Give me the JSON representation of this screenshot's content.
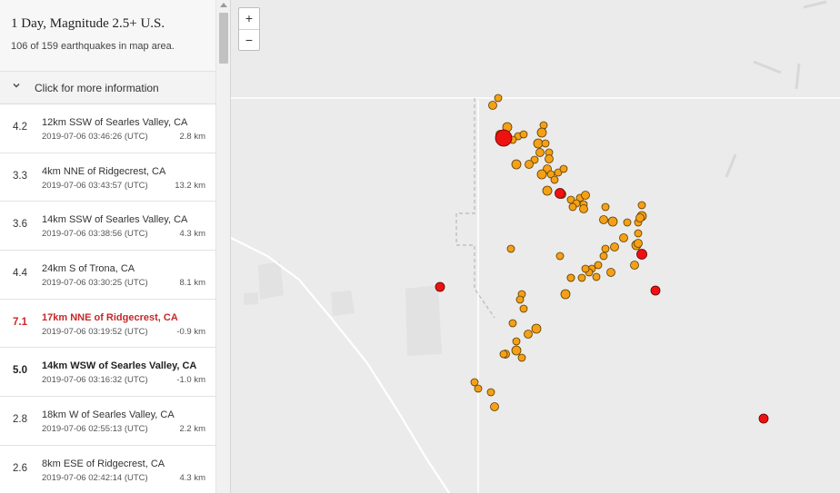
{
  "sidebar": {
    "title": "1 Day, Magnitude 2.5+ U.S.",
    "subtitle": "106 of 159 earthquakes in map area.",
    "more_info": "Click for more information"
  },
  "earthquakes": [
    {
      "mag": "4.2",
      "place": "12km SSW of Searles Valley, CA",
      "time": "2019-07-06 03:46:26 (UTC)",
      "depth": "2.8 km"
    },
    {
      "mag": "3.3",
      "place": "4km NNE of Ridgecrest, CA",
      "time": "2019-07-06 03:43:57 (UTC)",
      "depth": "13.2 km"
    },
    {
      "mag": "3.6",
      "place": "14km SSW of Searles Valley, CA",
      "time": "2019-07-06 03:38:56 (UTC)",
      "depth": "4.3 km"
    },
    {
      "mag": "4.4",
      "place": "24km S of Trona, CA",
      "time": "2019-07-06 03:30:25 (UTC)",
      "depth": "8.1 km"
    },
    {
      "mag": "7.1",
      "place": "17km NNE of Ridgecrest, CA",
      "time": "2019-07-06 03:19:52 (UTC)",
      "depth": "-0.9 km"
    },
    {
      "mag": "5.0",
      "place": "14km WSW of Searles Valley, CA",
      "time": "2019-07-06 03:16:32 (UTC)",
      "depth": "-1.0 km"
    },
    {
      "mag": "2.8",
      "place": "18km W of Searles Valley, CA",
      "time": "2019-07-06 02:55:13 (UTC)",
      "depth": "2.2 km"
    },
    {
      "mag": "2.6",
      "place": "8km ESE of Ridgecrest, CA",
      "time": "2019-07-06 02:42:14 (UTC)",
      "depth": "4.3 km"
    }
  ],
  "zoom": {
    "in": "+",
    "out": "−"
  },
  "colors": {
    "quake_orange": "#f5a016",
    "quake_red": "#ee1111",
    "highlight_text": "#c62828"
  }
}
